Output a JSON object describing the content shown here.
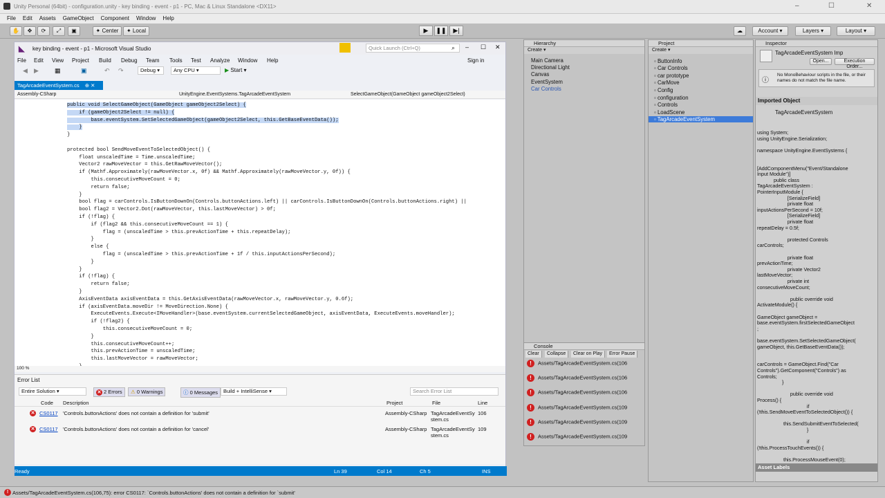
{
  "unity": {
    "title": "Unity Personal (64bit) - configuration.unity - key binding - event - p1 - PC, Mac & Linux Standalone <DX11>",
    "menu": [
      "File",
      "Edit",
      "Assets",
      "GameObject",
      "Component",
      "Window",
      "Help"
    ],
    "center_label": "Center",
    "local_label": "Local",
    "account_label": "Account",
    "layers_label": "Layers",
    "layout_label": "Layout",
    "status_text": "Assets/TagArcadeEventSystem.cs(106,75): error CS0117: `Controls.buttonActions' does not contain a definition for `submit'"
  },
  "vs": {
    "title": "key binding - event - p1 - Microsoft Visual Studio",
    "quick_launch": "Quick Launch (Ctrl+Q)",
    "sign_in": "Sign in",
    "menu": [
      "File",
      "Edit",
      "View",
      "Project",
      "Build",
      "Debug",
      "Team",
      "Tools",
      "Test",
      "Analyze",
      "Window",
      "Help"
    ],
    "config": "Debug",
    "platform": "Any CPU",
    "start": "Start",
    "tab": "TagArcadeEventSystem.cs",
    "nav": [
      "Assembly-CSharp",
      "UnityEngine.EventSystems.TagArcadeEventSystem",
      "SelectGameObject(GameObject gameObject2Select)"
    ],
    "code": [
      "public void SelectGameObject(GameObject gameObject2Select) {",
      "    if (gameObject2Select != null) {",
      "        base.eventSystem.SetSelectedGameObject(gameObject2Select, this.GetBaseEventData());",
      "    }",
      "}",
      "",
      "protected bool SendMoveEventToSelectedObject() {",
      "    float unscaledTime = Time.unscaledTime;",
      "    Vector2 rawMoveVector = this.GetRawMoveVector();",
      "    if (Mathf.Approximately(rawMoveVector.x, 0f) && Mathf.Approximately(rawMoveVector.y, 0f)) {",
      "        this.consecutiveMoveCount = 0;",
      "        return false;",
      "    }",
      "    bool flag = carControls.IsButtonDownOn(Controls.buttonActions.left) || carControls.IsButtonDownOn(Controls.buttonActions.right) ||",
      "    bool flag2 = Vector2.Dot(rawMoveVector, this.lastMoveVector) > 0f;",
      "    if (!flag) {",
      "        if (flag2 && this.consecutiveMoveCount == 1) {",
      "            flag = (unscaledTime > this.prevActionTime + this.repeatDelay);",
      "        }",
      "        else {",
      "            flag = (unscaledTime > this.prevActionTime + 1f / this.inputActionsPerSecond);",
      "        }",
      "    }",
      "    if (!flag) {",
      "        return false;",
      "    }",
      "    AxisEventData axisEventData = this.GetAxisEventData(rawMoveVector.x, rawMoveVector.y, 0.6f);",
      "    if (axisEventData.moveDir != MoveDirection.None) {",
      "        ExecuteEvents.Execute<IMoveHandler>(base.eventSystem.currentSelectedGameObject, axisEventData, ExecuteEvents.moveHandler);",
      "        if (!flag2) {",
      "            this.consecutiveMoveCount = 0;",
      "        }",
      "        this.consecutiveMoveCount++;",
      "        this.prevActionTime = unscaledTime;",
      "        this.lastMoveVector = rawMoveVector;",
      "    }"
    ],
    "zoom": "100 %",
    "errlist": {
      "title": "Error List",
      "scope": "Entire Solution",
      "errors": "2 Errors",
      "warnings": "0 Warnings",
      "messages": "0 Messages",
      "build": "Build + IntelliSense",
      "search": "Search Error List",
      "columns": [
        "Code",
        "Description",
        "Project",
        "File",
        "Line"
      ],
      "rows": [
        {
          "code": "CS0117",
          "desc": "'Controls.buttonActions' does not contain a definition for 'submit'",
          "project": "Assembly-CSharp",
          "file": "TagArcadeEventSy stem.cs",
          "line": "106"
        },
        {
          "code": "CS0117",
          "desc": "'Controls.buttonActions' does not contain a definition for 'cancel'",
          "project": "Assembly-CSharp",
          "file": "TagArcadeEventSy stem.cs",
          "line": "109"
        }
      ]
    },
    "status": {
      "ready": "Ready",
      "ln": "Ln 39",
      "col": "Col 14",
      "ch": "Ch 5",
      "ins": "INS"
    }
  },
  "hierarchy": {
    "title": "Hierarchy",
    "create": "Create",
    "items": [
      "Main Camera",
      "Directional Light",
      "Canvas",
      "EventSystem",
      "Car Controls"
    ]
  },
  "project": {
    "title": "Project",
    "create": "Create",
    "items": [
      "ButtonInfo",
      "Car Controls",
      "car prototype",
      "CarMove",
      "Config",
      "configuration",
      "Controls",
      "LoadScene",
      "TagArcadeEventSystem"
    ]
  },
  "console": {
    "title": "Console",
    "buttons": [
      "Clear",
      "Collapse",
      "Clear on Play",
      "Error Pause"
    ],
    "errors": [
      "Assets/TagArcadeEventSystem.cs(106",
      "Assets/TagArcadeEventSystem.cs(106",
      "Assets/TagArcadeEventSystem.cs(106",
      "Assets/TagArcadeEventSystem.cs(109",
      "Assets/TagArcadeEventSystem.cs(109",
      "Assets/TagArcadeEventSystem.cs(109"
    ]
  },
  "inspector": {
    "title": "Inspector",
    "script_name": "TagArcadeEventSystem Imp",
    "open": "Open...",
    "exec_order": "Execution Order...",
    "warning": "No MonoBehaviour scripts in the file, or their names do not match the file name.",
    "imported_header": "Imported Object",
    "imported_name": "TagArcadeEventSystem",
    "code": [
      "using System;",
      "using UnityEngine.Serialization;",
      "",
      "namespace UnityEngine.EventSystems {",
      "",
      "",
      "[AddComponentMenu(\"Event/Standalone",
      "Input Module\")]",
      "            public class",
      "TagArcadeEventSystem :",
      "PointerInputModule {",
      "                      [SerializeField]",
      "                      private float",
      "inputActionsPerSecond = 10f;",
      "                      [SerializeField]",
      "                      private float",
      "repeatDelay = 0.5f;",
      "",
      "                      protected Controls",
      "carControls;",
      "",
      "                      private float",
      "prevActionTime;",
      "                      private Vector2",
      "lastMoveVector;",
      "                      private int",
      "consecutiveMoveCount;",
      "",
      "                        public override void",
      "ActivateModule() {",
      "",
      "GameObject gameObject =",
      "base.eventSystem.firstSelectedGameObject",
      ";",
      "",
      "base.eventSystem.SetSelectedGameObject(",
      "gameObject, this.GetBaseEventData());",
      "",
      "",
      "carControls = GameObject.Find(\"Car",
      "Controls\").GetComponent(\"Controls\") as",
      "Controls;",
      "                  }",
      "",
      "                        public override void",
      "Process() {",
      "                                    if",
      "(!this.SendMoveEventToSelectedObject()) {",
      "",
      "                   this.SendSubmitEventToSelected(",
      "                                    }",
      "",
      "                                    if",
      "(!this.ProcessTouchEvents()) {",
      "",
      "                   this.ProcessMouseEvent(0);"
    ],
    "asset_labels": "Asset Labels"
  }
}
